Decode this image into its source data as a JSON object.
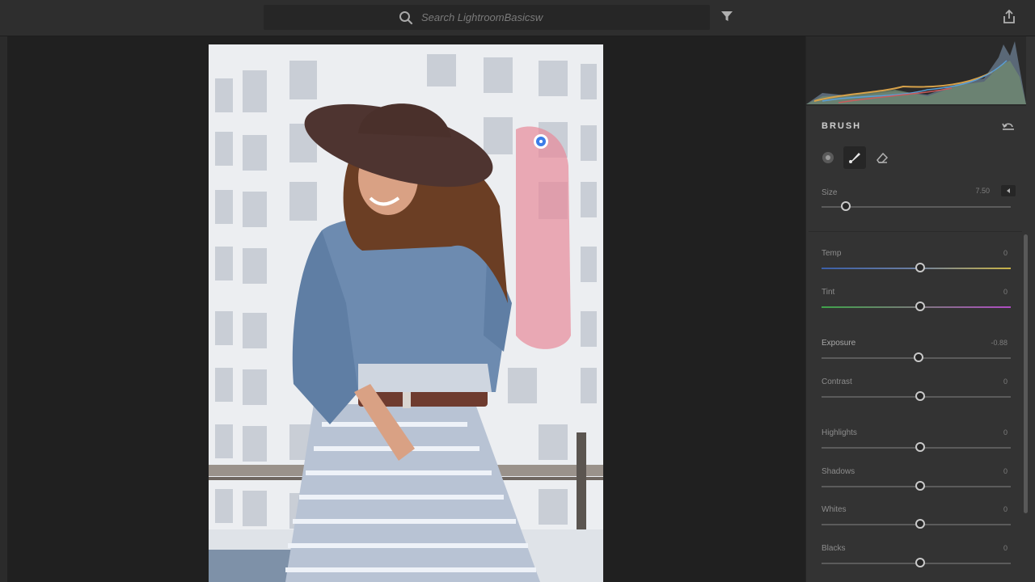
{
  "search": {
    "placeholder": "Search LightroomBasicsw"
  },
  "icons": {
    "search": "search-icon",
    "filter": "filter-icon",
    "share": "share-icon",
    "reset": "reset-icon",
    "tools": [
      "flow-icon",
      "brush-icon",
      "eraser-icon"
    ]
  },
  "panel": {
    "title": "BRUSH",
    "size": {
      "label": "Size",
      "value": "7.50",
      "level": 0.13
    },
    "sliders": [
      {
        "label": "Temp",
        "value": "0",
        "level": 0.5,
        "track": "temp"
      },
      {
        "label": "Tint",
        "value": "0",
        "level": 0.5,
        "track": "tint"
      },
      {
        "label": "Exposure",
        "value": "-0.88",
        "level": 0.49,
        "track": "plain"
      },
      {
        "label": "Contrast",
        "value": "0",
        "level": 0.5,
        "track": "plain"
      },
      {
        "label": "Highlights",
        "value": "0",
        "level": 0.5,
        "track": "plain"
      },
      {
        "label": "Shadows",
        "value": "0",
        "level": 0.5,
        "track": "plain"
      },
      {
        "label": "Whites",
        "value": "0",
        "level": 0.5,
        "track": "plain"
      },
      {
        "label": "Blacks",
        "value": "0",
        "level": 0.5,
        "track": "plain"
      }
    ]
  },
  "colors": {
    "accent_pin": "#3b7de8",
    "brush_mask": "#e88a9a"
  }
}
